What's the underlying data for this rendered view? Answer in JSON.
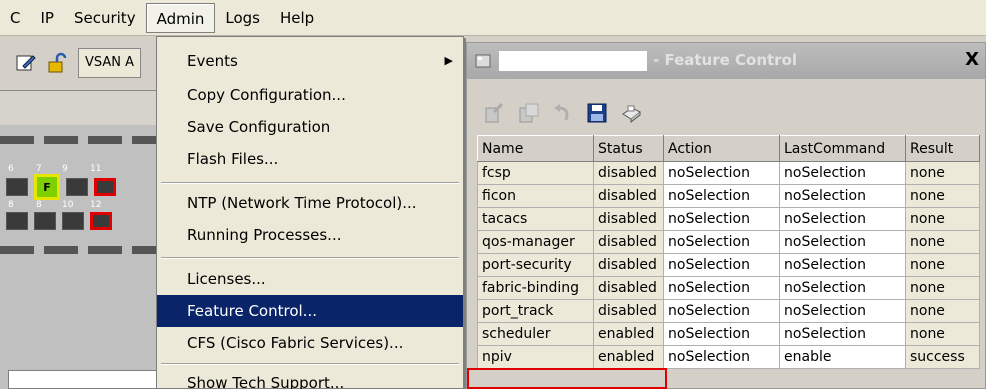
{
  "menubar": {
    "items": [
      "C",
      "IP",
      "Security",
      "Admin",
      "Logs",
      "Help"
    ]
  },
  "toolbar": {
    "vsan_label": "VSAN A"
  },
  "switch": {
    "top_ports": [
      "6",
      "7",
      "9",
      "11"
    ],
    "bottom_ports": [
      "8",
      "8",
      "10",
      "12"
    ],
    "fc_port_label": "F"
  },
  "admin_menu": {
    "items": [
      {
        "label": "Events",
        "submenu": true
      },
      {
        "label": "Copy Configuration..."
      },
      {
        "label": "Save Configuration"
      },
      {
        "label": "Flash Files..."
      },
      {
        "label": "NTP (Network Time Protocol)..."
      },
      {
        "label": "Running Processes..."
      },
      {
        "label": "Licenses..."
      },
      {
        "label": "Feature Control...",
        "selected": true
      },
      {
        "label": "CFS (Cisco Fabric Services)..."
      },
      {
        "label": "Show Tech Support..."
      }
    ]
  },
  "feature_window": {
    "title": "- Feature Control",
    "close_label": "X",
    "columns": [
      "Name",
      "Status",
      "Action",
      "LastCommand",
      "Result"
    ],
    "rows": [
      [
        "fcsp",
        "disabled",
        "noSelection",
        "noSelection",
        "none"
      ],
      [
        "ficon",
        "disabled",
        "noSelection",
        "noSelection",
        "none"
      ],
      [
        "tacacs",
        "disabled",
        "noSelection",
        "noSelection",
        "none"
      ],
      [
        "qos-manager",
        "disabled",
        "noSelection",
        "noSelection",
        "none"
      ],
      [
        "port-security",
        "disabled",
        "noSelection",
        "noSelection",
        "none"
      ],
      [
        "fabric-binding",
        "disabled",
        "noSelection",
        "noSelection",
        "none"
      ],
      [
        "port_track",
        "disabled",
        "noSelection",
        "noSelection",
        "none"
      ],
      [
        "scheduler",
        "enabled",
        "noSelection",
        "noSelection",
        "none"
      ],
      [
        "npiv",
        "enabled",
        "noSelection",
        "enable",
        "success"
      ]
    ]
  },
  "colors": {
    "selection": "#0a246a",
    "highlight_box": "#e00000"
  }
}
